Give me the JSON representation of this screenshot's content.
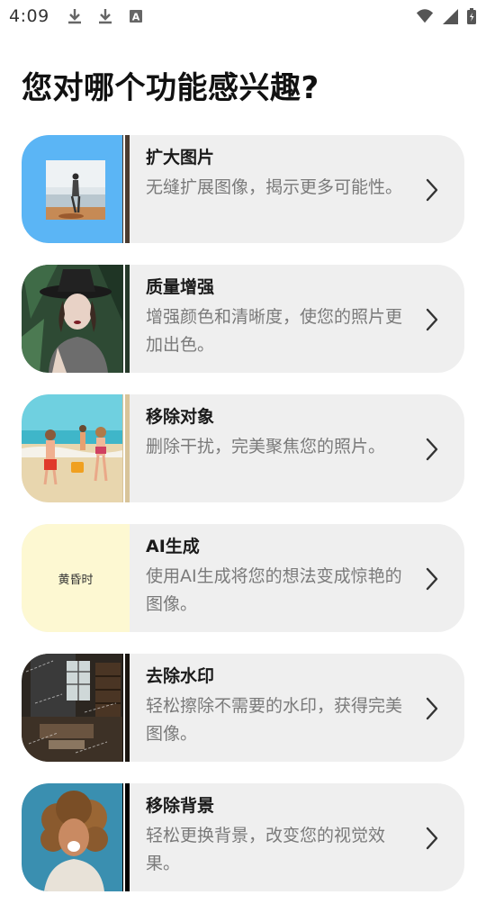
{
  "status_bar": {
    "time": "4:09",
    "left_icons": [
      "download-icon",
      "download-icon",
      "a-icon"
    ],
    "right_icons": [
      "wifi-icon",
      "signal-icon",
      "battery-icon"
    ]
  },
  "title": "您对哪个功能感兴趣?",
  "features": [
    {
      "title": "扩大图片",
      "description": "无缝扩展图像，揭示更多可能性。",
      "thumb": "beach-person-image"
    },
    {
      "title": "质量增强",
      "description": "增强颜色和清晰度，使您的照片更加出色。",
      "thumb": "portrait-hat-image"
    },
    {
      "title": "移除对象",
      "description": "删除干扰，完美聚焦您的照片。",
      "thumb": "kids-beach-image"
    },
    {
      "title": "AI生成",
      "description": "使用AI生成将您的想法变成惊艳的图像。",
      "thumb_text": "黄昏时",
      "thumb_color": "#fdf8d2"
    },
    {
      "title": "去除水印",
      "description": "轻松擦除不需要的水印，获得完美图像。",
      "thumb": "room-watermark-image"
    },
    {
      "title": "移除背景",
      "description": "轻松更换背景，改变您的视觉效果。",
      "thumb": "curly-hair-person-image"
    }
  ],
  "colors": {
    "card_bg": "#efefef",
    "title": "#111111",
    "desc": "#7a7a7a"
  }
}
